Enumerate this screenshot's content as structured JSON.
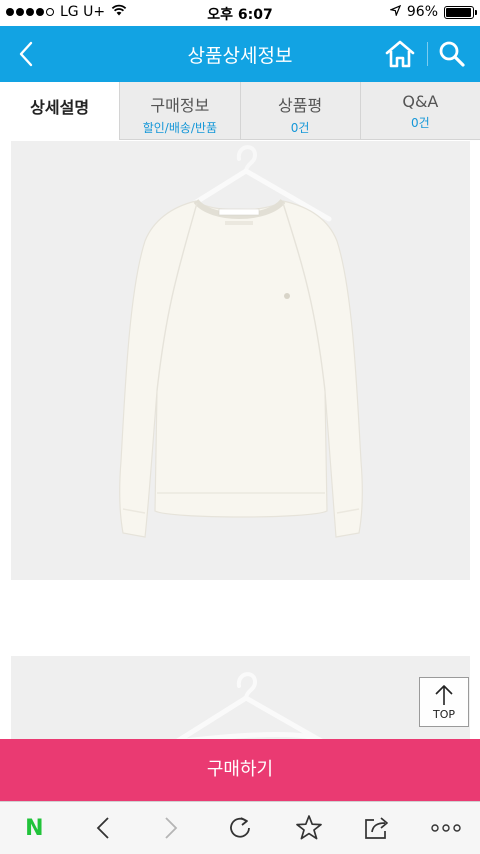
{
  "status_bar": {
    "carrier": "LG U+",
    "time": "오후 6:07",
    "battery": "96%",
    "battery_level": 0.96
  },
  "header": {
    "title": "상품상세정보"
  },
  "tabs": [
    {
      "label": "상세설명",
      "sub": ""
    },
    {
      "label": "구매정보",
      "sub": "할인/배송/반품"
    },
    {
      "label": "상품평",
      "sub": "0건"
    },
    {
      "label": "Q&A",
      "sub": "0건"
    }
  ],
  "top_button": {
    "label": "TOP"
  },
  "buy_button": {
    "label": "구매하기"
  },
  "toolbar": {
    "naver_logo": "N"
  },
  "colors": {
    "header": "#12a3e3",
    "buy": "#ea3a72",
    "tab_sub": "#1597d8",
    "naver": "#21c33a"
  }
}
